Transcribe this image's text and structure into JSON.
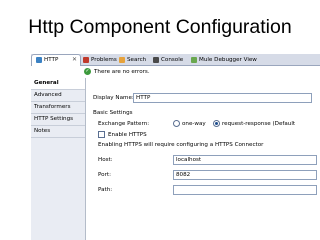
{
  "slide": {
    "title": "Http Component Configuration"
  },
  "tabs": [
    {
      "label": "HTTP",
      "icon": "http-icon"
    },
    {
      "label": "Problems",
      "icon": "problems-icon"
    },
    {
      "label": "Search",
      "icon": "search-icon"
    },
    {
      "label": "Console",
      "icon": "console-icon"
    },
    {
      "label": "Mule Debugger View",
      "icon": "debugger-icon"
    }
  ],
  "status": {
    "text": "There are no errors.",
    "icon": "check-icon"
  },
  "sidebar": {
    "items": [
      {
        "label": "General",
        "active": true
      },
      {
        "label": "Advanced"
      },
      {
        "label": "Transformers"
      },
      {
        "label": "HTTP Settings"
      },
      {
        "label": "Notes"
      }
    ]
  },
  "form": {
    "display_name_label": "Display Name:",
    "display_name_value": "HTTP",
    "basic_settings_label": "Basic Settings",
    "exchange_pattern_label": "Exchange Pattern:",
    "exchange_options": [
      "one-way",
      "request-response (Default"
    ],
    "exchange_selected": "request-response (Default",
    "enable_https_label": "Enable HTTPS",
    "https_note": "Enabling HTTPS will require configuring a HTTPS Connector",
    "host_label": "Host:",
    "host_value": "localhost",
    "port_label": "Port:",
    "port_value": "8082",
    "path_label": "Path:",
    "path_value": ""
  }
}
